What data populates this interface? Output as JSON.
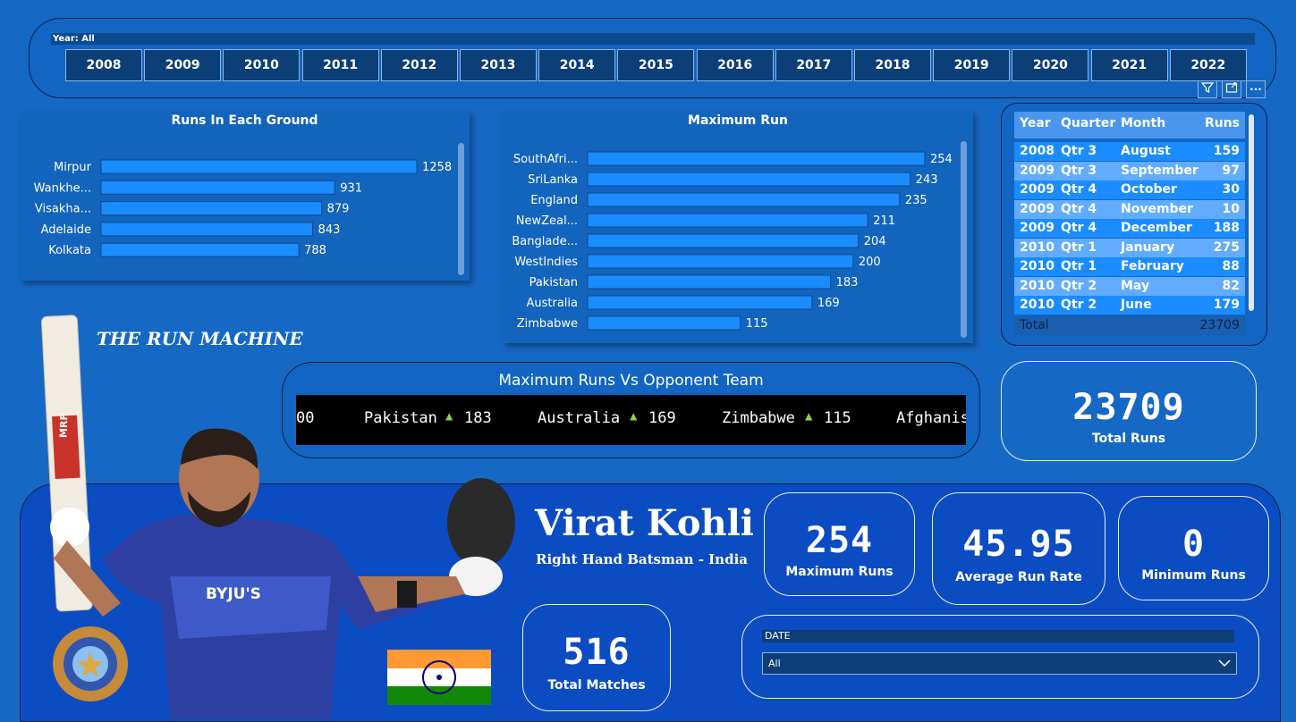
{
  "year_slicer": {
    "header": "Year: All",
    "years": [
      "2008",
      "2009",
      "2010",
      "2011",
      "2012",
      "2013",
      "2014",
      "2015",
      "2016",
      "2017",
      "2018",
      "2019",
      "2020",
      "2021",
      "2022"
    ]
  },
  "toolbar": {
    "filter_icon": "filter-icon",
    "focus_icon": "focus-mode-icon",
    "more_icon": "more-options-icon",
    "more_label": "···"
  },
  "runs_ground": {
    "title": "Runs In Each Ground",
    "chart_data": {
      "type": "bar",
      "categories": [
        "Mirpur",
        "Wankhe...",
        "Visakha...",
        "Adelaide",
        "Kolkata"
      ],
      "values": [
        1258,
        931,
        879,
        843,
        788
      ]
    }
  },
  "max_run": {
    "title": "Maximum Run",
    "chart_data": {
      "type": "bar",
      "categories": [
        "SouthAfri...",
        "SriLanka",
        "England",
        "NewZeal...",
        "Banglade...",
        "WestIndies",
        "Pakistan",
        "Australia",
        "Zimbabwe"
      ],
      "values": [
        254,
        243,
        235,
        211,
        204,
        200,
        183,
        169,
        115
      ]
    }
  },
  "table": {
    "headers": [
      "Year",
      "Quarter",
      "Month",
      "Runs"
    ],
    "rows": [
      [
        "2008",
        "Qtr 3",
        "August",
        "159"
      ],
      [
        "2009",
        "Qtr 3",
        "September",
        "97"
      ],
      [
        "2009",
        "Qtr 4",
        "October",
        "30"
      ],
      [
        "2009",
        "Qtr 4",
        "November",
        "10"
      ],
      [
        "2009",
        "Qtr 4",
        "December",
        "188"
      ],
      [
        "2010",
        "Qtr 1",
        "January",
        "275"
      ],
      [
        "2010",
        "Qtr 1",
        "February",
        "88"
      ],
      [
        "2010",
        "Qtr 2",
        "May",
        "82"
      ],
      [
        "2010",
        "Qtr 2",
        "June",
        "179"
      ]
    ],
    "total_label": "Total",
    "total_value": "23709"
  },
  "tagline": "THE RUN MACHINE",
  "ticker": {
    "title": "Maximum Runs Vs Opponent Team",
    "items": [
      {
        "prefix": "",
        "team": "",
        "value": "00"
      },
      {
        "team": "Pakistan",
        "value": "183"
      },
      {
        "team": "Australia",
        "value": "169"
      },
      {
        "team": "Zimbabwe",
        "value": "115"
      },
      {
        "team": "Afghanis",
        "value": ""
      }
    ],
    "arrow": "▲"
  },
  "total_runs": {
    "value": "23709",
    "label": "Total Runs"
  },
  "player": {
    "name": "Virat Kohli",
    "role": "Right Hand Batsman - India",
    "bat_text": "MRF",
    "jersey_text": "BYJU'S"
  },
  "stats": [
    {
      "value": "254",
      "label": "Maximum Runs"
    },
    {
      "value": "45.95",
      "label": "Average Run Rate"
    },
    {
      "value": "0",
      "label": "Minimum Runs"
    }
  ],
  "total_matches": {
    "value": "516",
    "label": "Total Matches"
  },
  "date_slicer": {
    "header": "DATE",
    "selected": "All"
  },
  "colors": {
    "background": "#1668c5",
    "bar": "#1a8cff",
    "table_row_alt": "#62acff",
    "table_row": "#1a8cff",
    "ticker_bg": "#000000",
    "arrow": "#8fd14f"
  }
}
